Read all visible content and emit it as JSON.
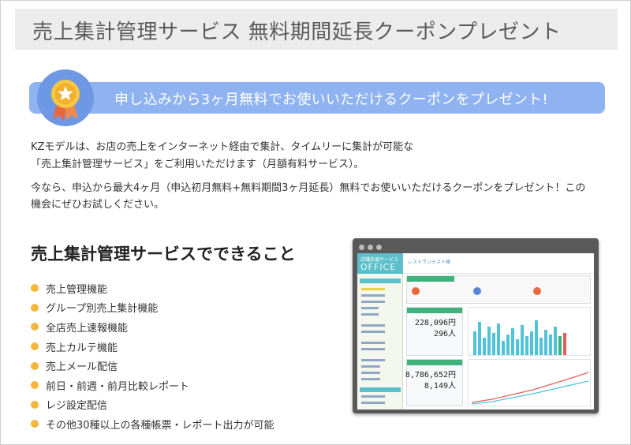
{
  "header": {
    "title": "売上集計管理サービス 無料期間延長クーポンプレゼント"
  },
  "banner": {
    "text": "申し込みから3ヶ月無料でお使いいただけるクーポンをプレゼント!",
    "icon": "award-medal-icon"
  },
  "intro": {
    "line1": "KZモデルは、お店の売上をインターネット経由で集計、タイムリーに集計が可能な",
    "line2": "「売上集計管理サービス」をご利用いただけます（月額有料サービス）。",
    "line3": "今なら、申込から最大4ヶ月（申込初月無料+無料期間3ヶ月延長）無料でお使いいただけるクーポンをプレゼント！この",
    "line4": "機会にぜひお試しください。"
  },
  "features": {
    "title": "売上集計管理サービスでできること",
    "items": [
      "売上管理機能",
      "グループ別売上集計機能",
      "全店売上速報機能",
      "売上カルテ機能",
      "売上メール配信",
      "前日・前週・前月比較レポート",
      "レジ設定配信",
      "その他30種以上の各種帳票・レポート出力が可能"
    ]
  },
  "mockup": {
    "brand_small": "店舗支援サービス",
    "brand_big": "OFFICE",
    "top_title": "レストランテスト様",
    "sales_value": "228,096円",
    "customers_value": "296人",
    "month_sales_value": "8,786,652円",
    "month_customers_value": "8,149人"
  },
  "colors": {
    "banner": "#8fb3f0",
    "bullet": "#f5b73b",
    "header_bg": "#ececec",
    "mock_accent": "#5bc0c9",
    "mock_green": "#3fb27c"
  }
}
